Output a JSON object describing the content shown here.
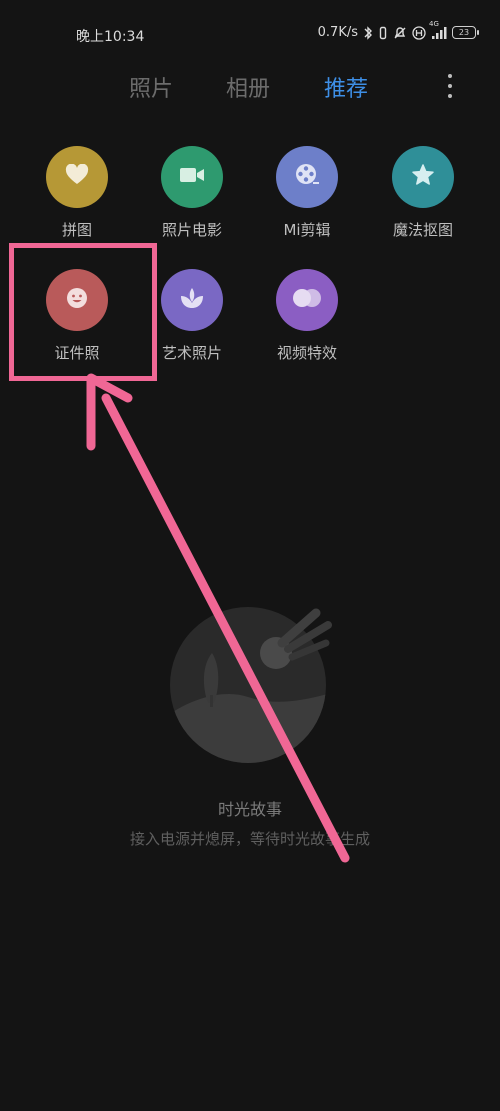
{
  "status_bar": {
    "time": "晚上10:34",
    "network_speed": "0.7K/s",
    "network_type": "4G",
    "battery": "23",
    "icons": [
      "bluetooth-icon",
      "vibrate-icon",
      "do-not-disturb-icon",
      "hd-icon",
      "signal-icon",
      "battery-icon"
    ]
  },
  "tabs": [
    {
      "label": "照片",
      "active": false
    },
    {
      "label": "相册",
      "active": false
    },
    {
      "label": "推荐",
      "active": true
    }
  ],
  "tools": [
    {
      "label": "拼图",
      "icon": "heart-icon",
      "color": "#b69836"
    },
    {
      "label": "照片电影",
      "icon": "video-camera-icon",
      "color": "#2e9a6f"
    },
    {
      "label": "Mi剪辑",
      "icon": "film-reel-icon",
      "color": "#6d7fc9"
    },
    {
      "label": "魔法抠图",
      "icon": "star-icon",
      "color": "#2f8f98"
    },
    {
      "label": "证件照",
      "icon": "smile-face-icon",
      "color": "#b95a5a"
    },
    {
      "label": "艺术照片",
      "icon": "leaf-icon",
      "color": "#7a68c4"
    },
    {
      "label": "视频特效",
      "icon": "bubbles-icon",
      "color": "#8b5ec3"
    }
  ],
  "empty_state": {
    "title": "时光故事",
    "subtitle": "接入电源并熄屏，等待时光故事生成"
  },
  "annotation": {
    "color": "#f06795"
  }
}
